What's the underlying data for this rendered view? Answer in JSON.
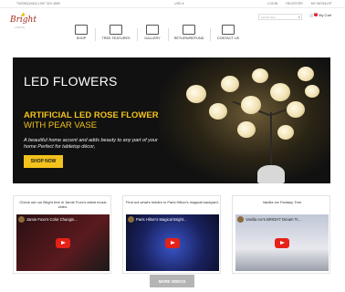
{
  "topbar": {
    "phone": "TWO50(2463) 1957 323 4559",
    "currency": "USD ▾",
    "links": [
      "LOGIN",
      "REGISTER",
      "MY WISHLIST"
    ]
  },
  "logo": {
    "text": "Bright",
    "sub": "LIGHTS"
  },
  "search": {
    "placeholder": "search here"
  },
  "cart": {
    "label": "My Cart",
    "count": "0"
  },
  "nav": [
    {
      "label": "SHOP",
      "icon": "shop-icon"
    },
    {
      "label": "TREE FEATURES",
      "icon": "tree-features-icon"
    },
    {
      "label": "GALLERY",
      "icon": "gallery-icon"
    },
    {
      "label": "RETURN/REFUND",
      "icon": "return-icon"
    },
    {
      "label": "CONTACT US",
      "icon": "contact-icon"
    }
  ],
  "hero": {
    "title": "LED FLOWERS",
    "headline": "ARTIFICIAL LED ROSE FLOWER",
    "subhead": "WITH PEAR VASE",
    "description": "A beautiful home accent and adds beauty to any part of your home Perfect for tabletop décor,",
    "cta": "SHOP NOW"
  },
  "videos": [
    {
      "caption": "Check out our Bright tree in Jamie Foxx's latest music video.",
      "title": "Jamie Foxx's Color Changin..."
    },
    {
      "caption": "Find out what's hidden in Paris Hilton's magical backyard.",
      "title": "Paris Hilton's Magical Bright..."
    },
    {
      "caption": "Vanilla Ice Fantasy Tree",
      "title": "Vanilla Ice's BRIGHT Dream Tr..."
    }
  ],
  "more_button": "MORE VIDEOS",
  "colors": {
    "accent": "#f3c21c",
    "brand": "#a0291a",
    "hero_bg": "#111111",
    "youtube": "#e62117"
  }
}
